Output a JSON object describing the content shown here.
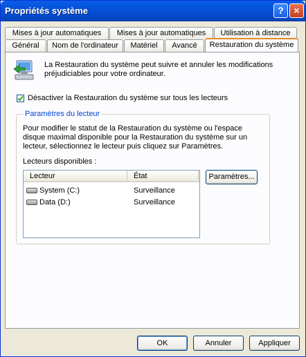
{
  "window": {
    "title": "Propriétés système",
    "help_button": "?",
    "close_button": "×"
  },
  "tabs_row1": [
    {
      "label": "Mises à jour automatiques"
    },
    {
      "label": "Mises à jour automatiques"
    },
    {
      "label": "Utilisation à distance"
    }
  ],
  "tabs_row2": [
    {
      "label": "Général"
    },
    {
      "label": "Nom de l'ordinateur"
    },
    {
      "label": "Matériel"
    },
    {
      "label": "Avancé"
    },
    {
      "label": "Restauration du système",
      "active": true
    }
  ],
  "intro_text": "La Restauration du système peut suivre et annuler les modifications préjudiciables pour votre ordinateur.",
  "disable_checkbox": {
    "label": "Désactiver la Restauration du système sur tous les lecteurs",
    "checked": true
  },
  "group": {
    "label": "Paramètres du lecteur",
    "description": "Pour modifier le statut de la Restauration du système ou l'espace disque maximal disponible pour la Restauration du système sur un lecteur, sélectionnez le lecteur puis cliquez sur Paramètres.",
    "drives_label": "Lecteurs disponibles :",
    "columns": {
      "drive": "Lecteur",
      "state": "État"
    },
    "drives": [
      {
        "name": "System (C:)",
        "state": "Surveillance"
      },
      {
        "name": "Data (D:)",
        "state": "Surveillance"
      }
    ],
    "settings_button": "Paramètres..."
  },
  "footer": {
    "ok": "OK",
    "cancel": "Annuler",
    "apply": "Appliquer"
  },
  "colors": {
    "titlebar": "#0552d8",
    "group_label": "#0046d5",
    "active_tab_accent": "#e68b2c",
    "dialog_bg": "#ece9d8"
  }
}
